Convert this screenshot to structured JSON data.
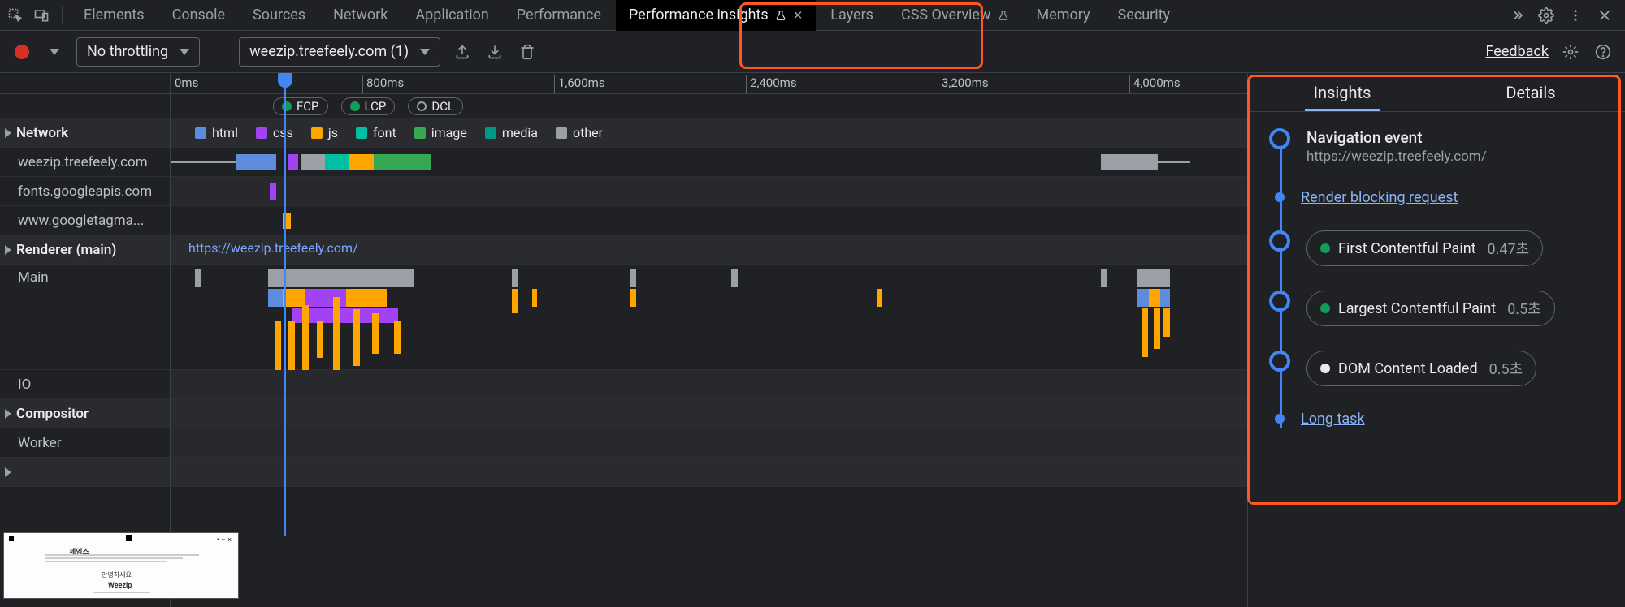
{
  "tabs": {
    "elements": "Elements",
    "console": "Console",
    "sources": "Sources",
    "network": "Network",
    "application": "Application",
    "performance": "Performance",
    "performance_insights": "Performance insights",
    "layers": "Layers",
    "css_overview": "CSS Overview",
    "memory": "Memory",
    "security": "Security"
  },
  "toolbar": {
    "throttling": "No throttling",
    "page_select": "weezip.treefeely.com (1)",
    "feedback": "Feedback"
  },
  "ruler": {
    "t0": "0ms",
    "t1": "800ms",
    "t2": "1,600ms",
    "t3": "2,400ms",
    "t4": "3,200ms",
    "t5": "4,000ms"
  },
  "metrics": {
    "fcp": "FCP",
    "lcp": "LCP",
    "dcl": "DCL"
  },
  "legend": {
    "html": "html",
    "css": "css",
    "js": "js",
    "font": "font",
    "image": "image",
    "media": "media",
    "other": "other"
  },
  "tracks": {
    "network": "Network",
    "domain1": "weezip.treefeely.com",
    "domain2": "fonts.googleapis.com",
    "domain3": "www.googletagma...",
    "renderer": "Renderer (main)",
    "renderer_url": "https://weezip.treefeely.com/",
    "main": "Main",
    "io": "IO",
    "compositor": "Compositor",
    "worker": "Worker"
  },
  "right": {
    "tab_insights": "Insights",
    "tab_details": "Details",
    "nav_title": "Navigation event",
    "nav_url": "https://weezip.treefeely.com/",
    "render_blocking": "Render blocking request",
    "fcp_name": "First Contentful Paint",
    "fcp_val": "0.47초",
    "lcp_name": "Largest Contentful Paint",
    "lcp_val": "0.5초",
    "dcl_name": "DOM Content Loaded",
    "dcl_val": "0.5초",
    "long_task": "Long task"
  }
}
